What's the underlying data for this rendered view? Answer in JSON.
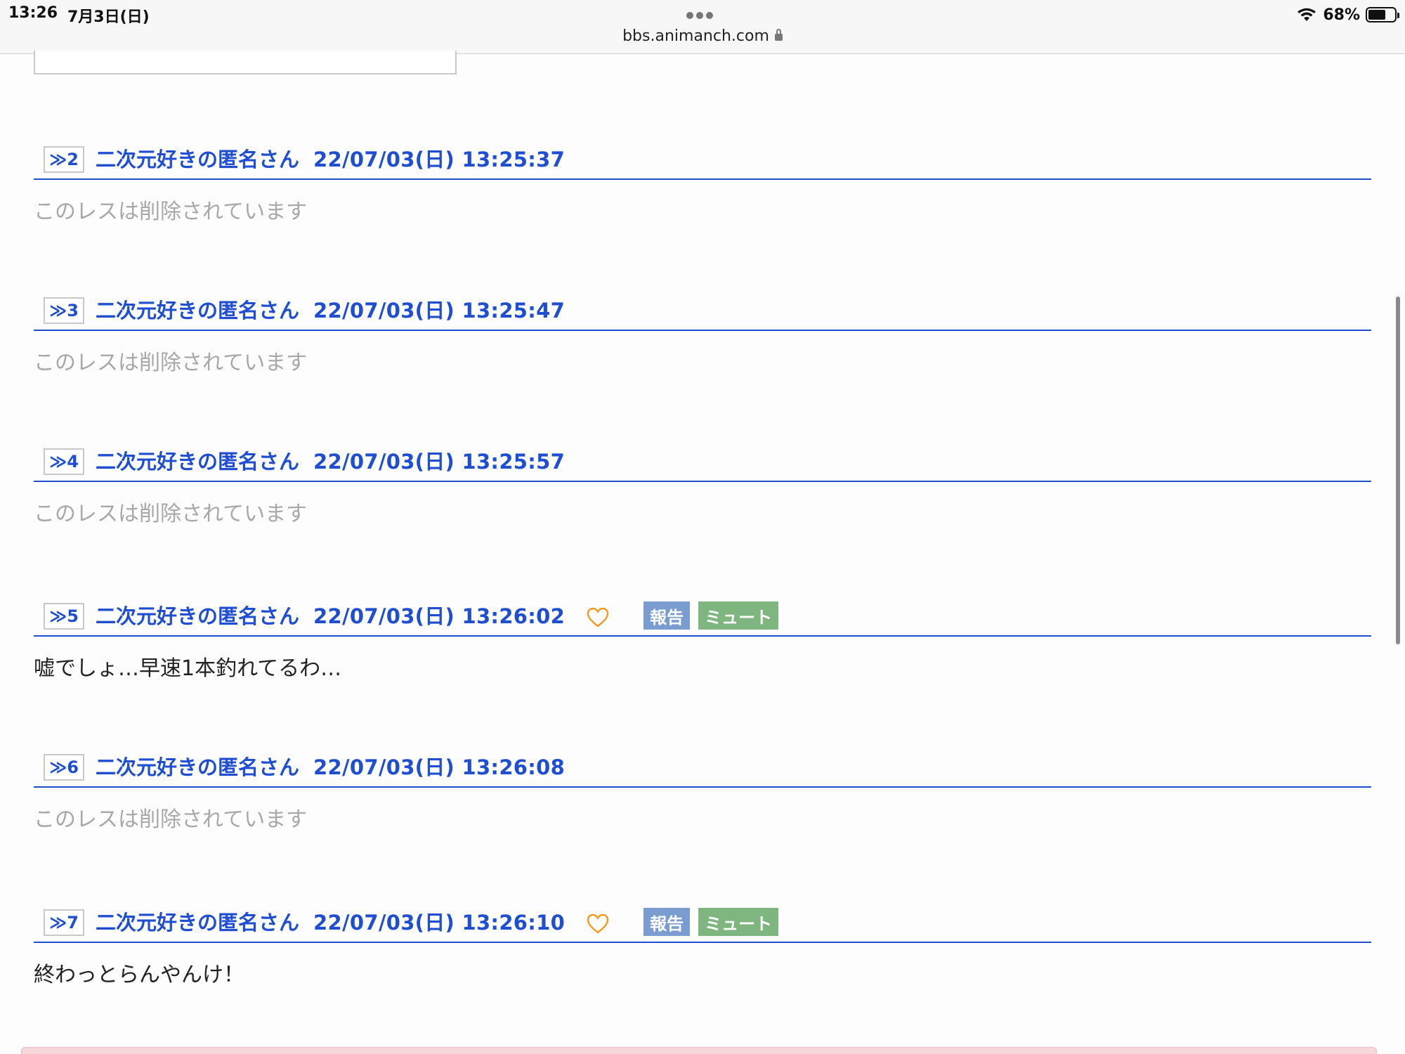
{
  "status_bar": {
    "time": "13:26",
    "date": "7月3日(日)",
    "url": "bbs.animanch.com",
    "battery": "68%"
  },
  "posts": [
    {
      "num": "≫2",
      "name": "二次元好きの匿名さん",
      "date": "22/07/03(日) 13:25:37",
      "body": "このレスは削除されています",
      "deleted": true
    },
    {
      "num": "≫3",
      "name": "二次元好きの匿名さん",
      "date": "22/07/03(日) 13:25:47",
      "body": "このレスは削除されています",
      "deleted": true
    },
    {
      "num": "≫4",
      "name": "二次元好きの匿名さん",
      "date": "22/07/03(日) 13:25:57",
      "body": "このレスは削除されています",
      "deleted": true
    },
    {
      "num": "≫5",
      "name": "二次元好きの匿名さん",
      "date": "22/07/03(日) 13:26:02",
      "body": "嘘でしょ…早速1本釣れてるわ…",
      "deleted": false,
      "report_label": "報告",
      "mute_label": "ミュート"
    },
    {
      "num": "≫6",
      "name": "二次元好きの匿名さん",
      "date": "22/07/03(日) 13:26:08",
      "body": "このレスは削除されています",
      "deleted": true
    },
    {
      "num": "≫7",
      "name": "二次元好きの匿名さん",
      "date": "22/07/03(日) 13:26:10",
      "body": "終わっとらんやんけ！",
      "deleted": false,
      "report_label": "報告",
      "mute_label": "ミュート"
    }
  ],
  "colors": {
    "link_blue": "#1f4fd0",
    "report_button": "#7b9ccf",
    "mute_button": "#7fb57f",
    "heart": "#f39a1e",
    "deleted_text": "#a8a8a8"
  }
}
